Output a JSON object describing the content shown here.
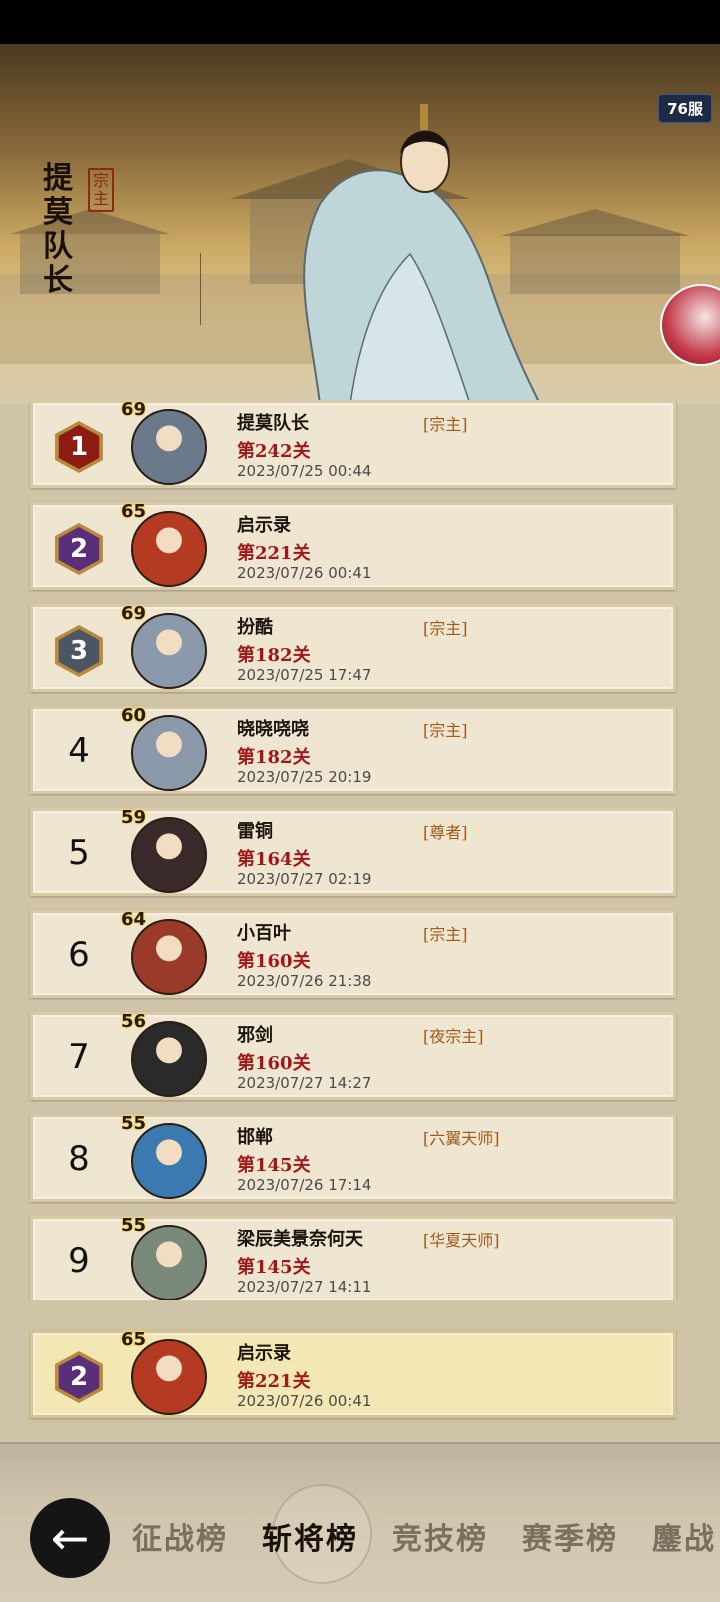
{
  "server": "76服",
  "hero": {
    "name": "提莫队长",
    "title": "宗主"
  },
  "leaderboard": [
    {
      "rank": "1",
      "medal": true,
      "level": "69",
      "name": "提莫队长",
      "title": "[宗主]",
      "stage": "第242关",
      "time": "2023/07/25 00:44",
      "avatar_color": "#6a7a8a"
    },
    {
      "rank": "2",
      "medal": true,
      "level": "65",
      "name": "启示录",
      "title": "",
      "stage": "第221关",
      "time": "2023/07/26 00:41",
      "avatar_color": "#b43a22"
    },
    {
      "rank": "3",
      "medal": true,
      "level": "69",
      "name": "扮酷",
      "title": "[宗主]",
      "stage": "第182关",
      "time": "2023/07/25 17:47",
      "avatar_color": "#8a9aaa"
    },
    {
      "rank": "4",
      "medal": false,
      "level": "60",
      "name": "晓晓哓哓",
      "title": "[宗主]",
      "stage": "第182关",
      "time": "2023/07/25 20:19",
      "avatar_color": "#8a9aaa"
    },
    {
      "rank": "5",
      "medal": false,
      "level": "59",
      "name": "雷铜",
      "title": "[尊者]",
      "stage": "第164关",
      "time": "2023/07/27 02:19",
      "avatar_color": "#3a2a2a"
    },
    {
      "rank": "6",
      "medal": false,
      "level": "64",
      "name": "小百叶",
      "title": "[宗主]",
      "stage": "第160关",
      "time": "2023/07/26 21:38",
      "avatar_color": "#9a3a2a"
    },
    {
      "rank": "7",
      "medal": false,
      "level": "56",
      "name": "邪剑",
      "title": "[夜宗主]",
      "stage": "第160关",
      "time": "2023/07/27 14:27",
      "avatar_color": "#2a2a2a"
    },
    {
      "rank": "8",
      "medal": false,
      "level": "55",
      "name": "邯郸",
      "title": "[六翼天师]",
      "stage": "第145关",
      "time": "2023/07/26 17:14",
      "avatar_color": "#3a7ab0"
    },
    {
      "rank": "9",
      "medal": false,
      "level": "55",
      "name": "梁辰美景奈何天",
      "title": "[华夏天师]",
      "stage": "第145关",
      "time": "2023/07/27 14:11",
      "avatar_color": "#7a8a7a"
    }
  ],
  "my_rank": {
    "rank": "2",
    "level": "65",
    "name": "启示录",
    "stage": "第221关",
    "time": "2023/07/26 00:41",
    "avatar_color": "#b43a22"
  },
  "tabs": [
    "征战榜",
    "斩将榜",
    "竞技榜",
    "赛季榜",
    "鏖战"
  ],
  "active_tab": "斩将榜",
  "back_icon": "←"
}
